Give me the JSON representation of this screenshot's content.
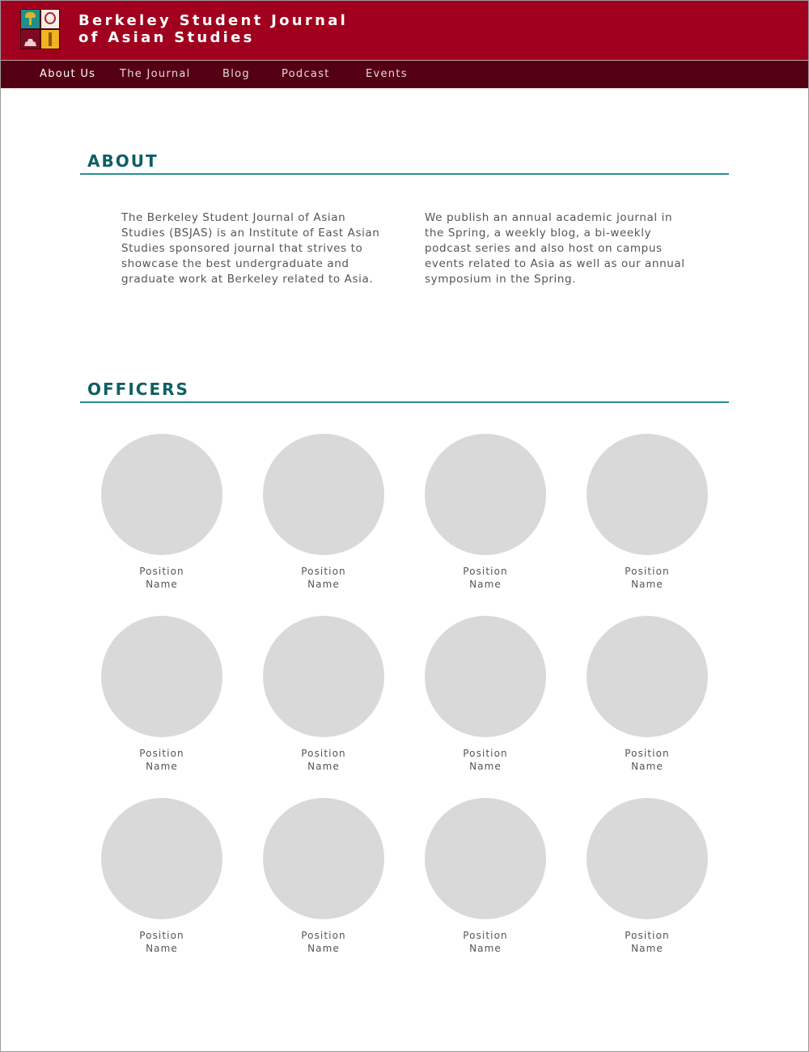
{
  "header": {
    "title_line1": "Berkeley Student Journal",
    "title_line2": "of Asian Studies"
  },
  "nav": {
    "items": [
      {
        "label": "About Us",
        "active": true
      },
      {
        "label": "The Journal",
        "active": false
      },
      {
        "label": "Blog",
        "active": false
      },
      {
        "label": "Podcast",
        "active": false
      },
      {
        "label": "Events",
        "active": false
      }
    ]
  },
  "about": {
    "heading": "ABOUT",
    "paragraph1": "The Berkeley Student Journal of Asian Studies (BSJAS) is an Institute of East Asian Studies sponsored journal that strives to showcase the best undergraduate and graduate work at Berkeley related to Asia.",
    "paragraph2": "We publish an annual academic journal in the Spring, a weekly blog, a bi-weekly podcast series and also host on campus events related to Asia as well as our annual symposium in the Spring."
  },
  "officers": {
    "heading": "OFFICERS",
    "list": [
      {
        "position": "Position",
        "name": "Name"
      },
      {
        "position": "Position",
        "name": "Name"
      },
      {
        "position": "Position",
        "name": "Name"
      },
      {
        "position": "Position",
        "name": "Name"
      },
      {
        "position": "Position",
        "name": "Name"
      },
      {
        "position": "Position",
        "name": "Name"
      },
      {
        "position": "Position",
        "name": "Name"
      },
      {
        "position": "Position",
        "name": "Name"
      },
      {
        "position": "Position",
        "name": "Name"
      },
      {
        "position": "Position",
        "name": "Name"
      },
      {
        "position": "Position",
        "name": "Name"
      },
      {
        "position": "Position",
        "name": "Name"
      }
    ]
  },
  "colors": {
    "header_bg": "#a0001e",
    "nav_bg": "#540012",
    "heading": "#0f5f64",
    "rule": "#2a8f95",
    "photo_placeholder": "#d9d9d9"
  },
  "icons": {
    "logo": "bsjas-logo-icon"
  }
}
